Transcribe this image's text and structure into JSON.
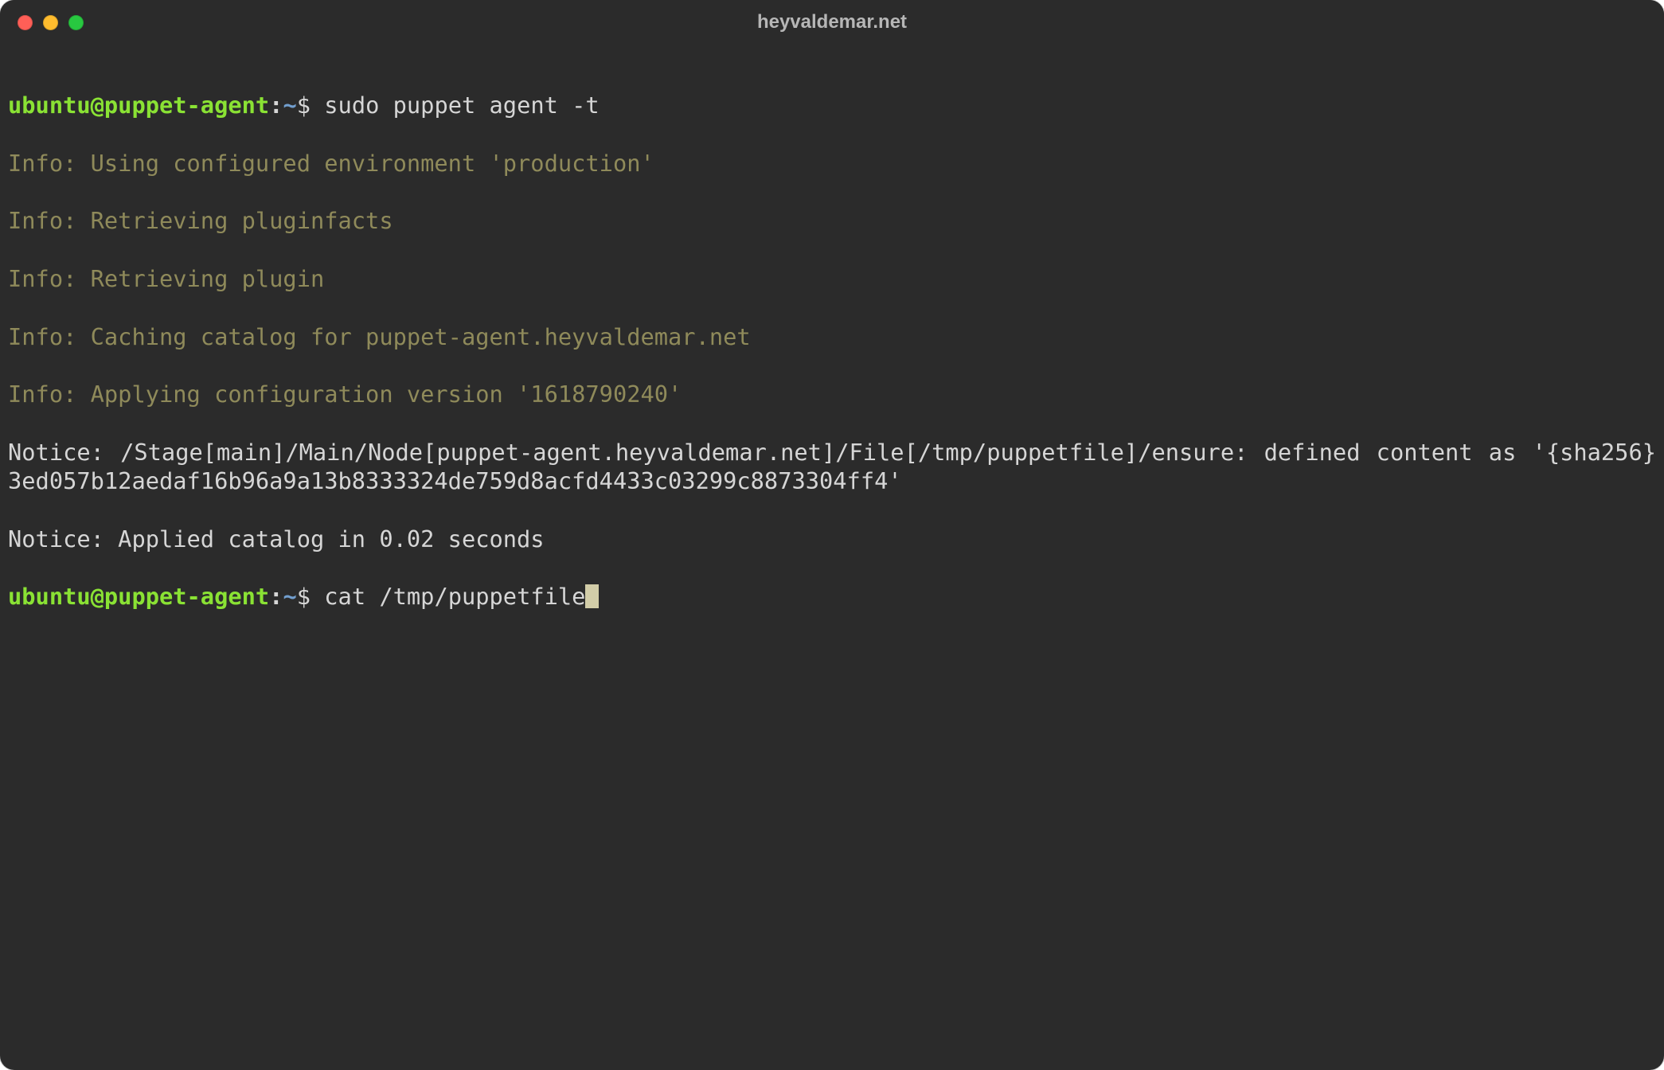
{
  "window": {
    "title": "heyvaldemar.net"
  },
  "prompt1": {
    "user_host": "ubuntu@puppet-agent",
    "sep": ":",
    "path": "~",
    "symbol": "$",
    "command": " sudo puppet agent -t"
  },
  "info_lines": {
    "l1": "Info: Using configured environment 'production'",
    "l2": "Info: Retrieving pluginfacts",
    "l3": "Info: Retrieving plugin",
    "l4": "Info: Caching catalog for puppet-agent.heyvaldemar.net",
    "l5": "Info: Applying configuration version '1618790240'"
  },
  "notice_lines": {
    "n1": "Notice: /Stage[main]/Main/Node[puppet-agent.heyvaldemar.net]/File[/tmp/puppetfile]/ensure: defined content as '{sha256}3ed057b12aedaf16b96a9a13b8333324de759d8acfd4433c03299c8873304ff4'",
    "n2": "Notice: Applied catalog in 0.02 seconds"
  },
  "prompt2": {
    "user_host": "ubuntu@puppet-agent",
    "sep": ":",
    "path": "~",
    "symbol": "$",
    "command": " cat /tmp/puppetfile"
  }
}
